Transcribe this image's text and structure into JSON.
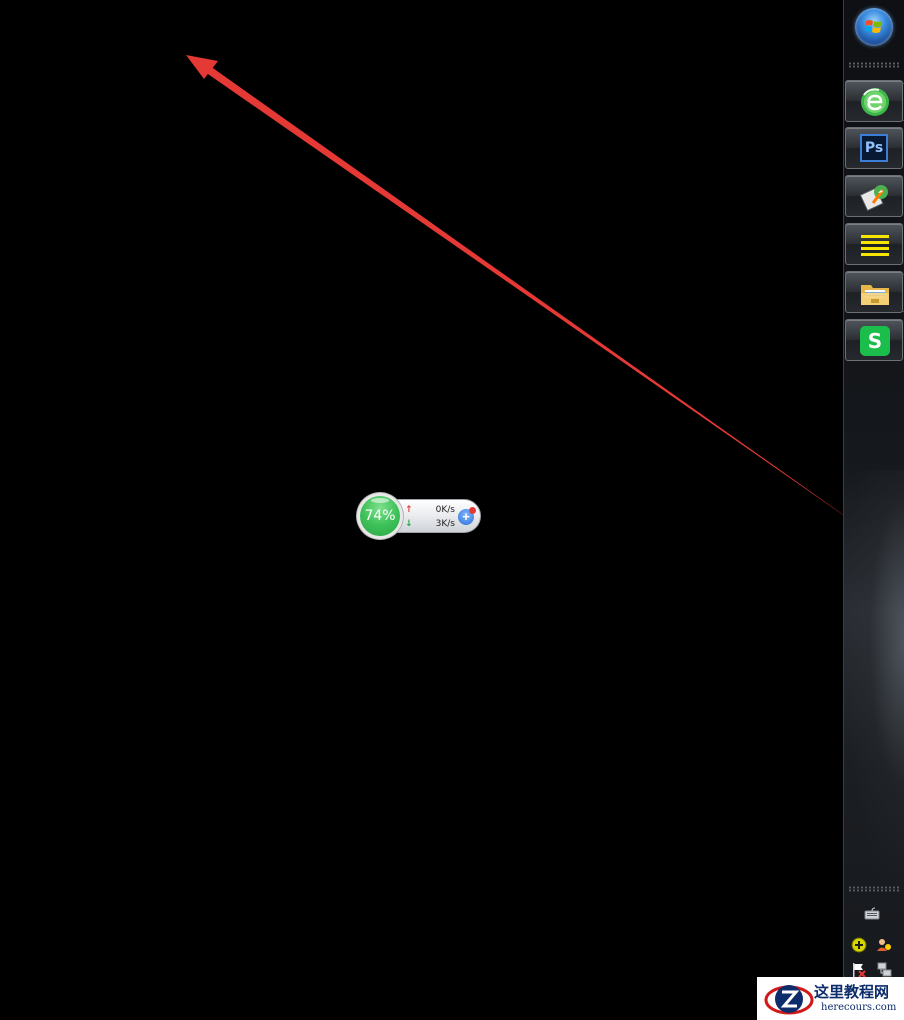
{
  "net_widget": {
    "percent": "74%",
    "upload": "0K/s",
    "download": "3K/s",
    "upload_arrow": "↑",
    "download_arrow": "↓",
    "plus": "+"
  },
  "taskbar": {
    "apps": [
      {
        "name": "360-browser",
        "icon": "e-refresh-icon"
      },
      {
        "name": "photoshop",
        "icon_text": "Ps"
      },
      {
        "name": "flash-tool",
        "icon": "flash-pen-icon"
      },
      {
        "name": "notes",
        "icon": "yellow-lines-icon"
      },
      {
        "name": "file-explorer",
        "icon": "folder-icon"
      },
      {
        "name": "wps-spreadsheet",
        "icon_text": "S"
      }
    ]
  },
  "watermark": {
    "title": "这里教程网",
    "url": "herecours.com"
  },
  "colors": {
    "arrow": "#e53935",
    "accent_green": "#3fc25a"
  }
}
